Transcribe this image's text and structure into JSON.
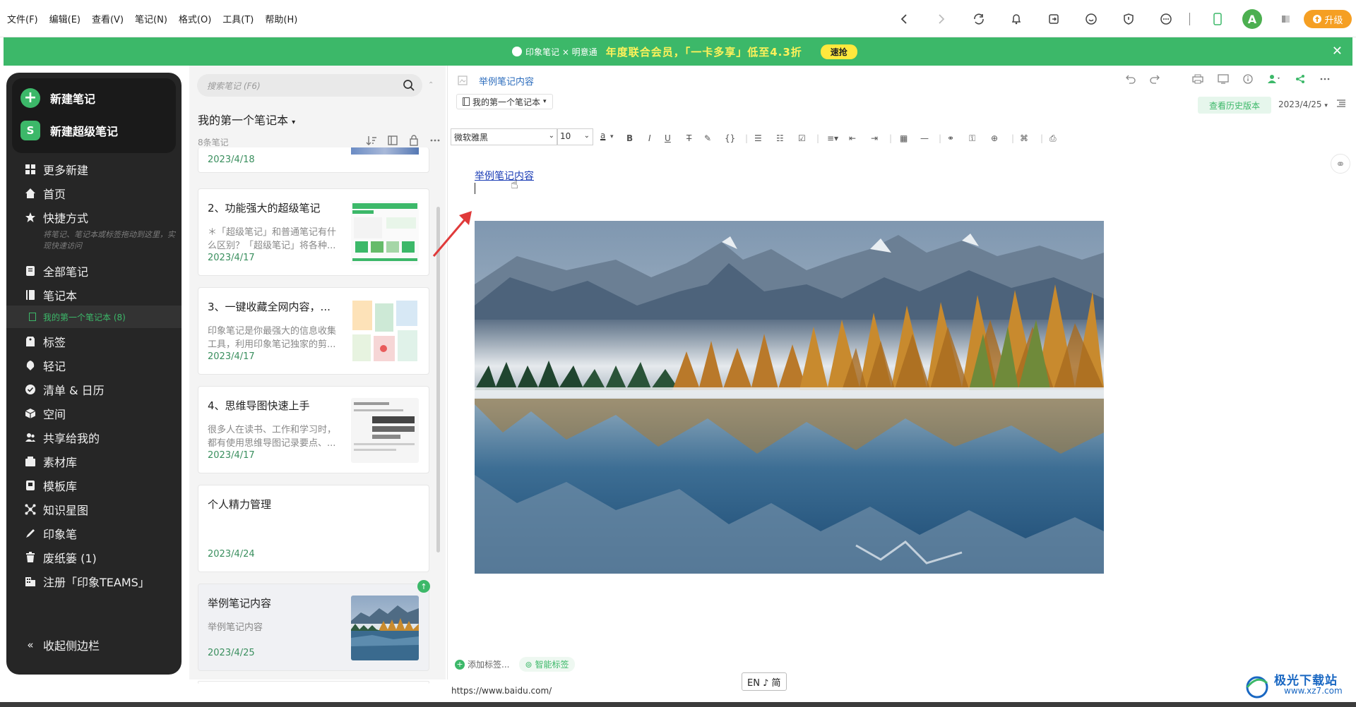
{
  "menu": [
    "文件(F)",
    "编辑(E)",
    "查看(V)",
    "笔记(N)",
    "格式(O)",
    "工具(T)",
    "帮助(H)"
  ],
  "topbar": {
    "upgrade_label": "升级",
    "avatar_letter": "A"
  },
  "banner": {
    "logo_text": "印象笔记 × 明意通",
    "text": "年度联合会员，「一卡多享」低至4.3折",
    "button": "速抢"
  },
  "sidebar": {
    "new_note": "新建笔记",
    "new_super_note": "新建超级笔记",
    "super_badge": "S",
    "items": [
      {
        "label": "更多新建"
      },
      {
        "label": "首页"
      },
      {
        "label": "快捷方式"
      },
      {
        "label": "全部笔记"
      },
      {
        "label": "笔记本"
      },
      {
        "label": "标签"
      },
      {
        "label": "轻记"
      },
      {
        "label": "清单 & 日历"
      },
      {
        "label": "空间"
      },
      {
        "label": "共享给我的"
      },
      {
        "label": "素材库"
      },
      {
        "label": "模板库"
      },
      {
        "label": "知识星图"
      },
      {
        "label": "印象笔"
      },
      {
        "label": "废纸篓 (1)"
      },
      {
        "label": "注册「印象TEAMS」"
      }
    ],
    "shortcut_hint": "将笔记、笔记本或标签拖动到这里，实现快速访问",
    "notebook_sub": "我的第一个笔记本 (8)",
    "collapse": "收起侧边栏"
  },
  "notelist": {
    "search_placeholder": "搜索笔记 (F6)",
    "notebook_title": "我的第一个笔记本",
    "count": "8条笔记",
    "partial_date": "2023/4/18",
    "notes": [
      {
        "title": "2、功能强大的超级笔记",
        "snippet": "＊「超级笔记」和普通笔记有什么区别？「超级笔记」将各种...",
        "date": "2023/4/17"
      },
      {
        "title": "3、一键收藏全网内容，...",
        "snippet": "印象笔记是你最强大的信息收集工具，利用印象笔记独家的剪...",
        "date": "2023/4/17"
      },
      {
        "title": "4、思维导图快速上手",
        "snippet": "很多人在读书、工作和学习时，都有使用思维导图记录要点、...",
        "date": "2023/4/17"
      },
      {
        "title": "个人精力管理",
        "snippet": "",
        "date": "2023/4/24"
      },
      {
        "title": "举例笔记内容",
        "snippet": "举例笔记内容",
        "date": "2023/4/25"
      }
    ]
  },
  "editor": {
    "title": "举例笔记内容",
    "notebook": "我的第一个笔记本",
    "history_button": "查看历史版本",
    "date": "2023/4/25",
    "font": "微软雅黑",
    "size": "10",
    "link_text": "举例笔记内容",
    "add_tag": "添加标签...",
    "smart_tag": "智能标签"
  },
  "statusbar": {
    "url": "https://www.baidu.com/",
    "ime": "EN ♪ 简"
  },
  "watermark": {
    "text": "极光下载站",
    "sub": "www.xz7.com"
  },
  "colors": {
    "brand_green": "#3cb869",
    "upgrade_orange": "#f59f23",
    "sidebar_bg": "#262626",
    "link_blue": "#1a3cb5"
  }
}
